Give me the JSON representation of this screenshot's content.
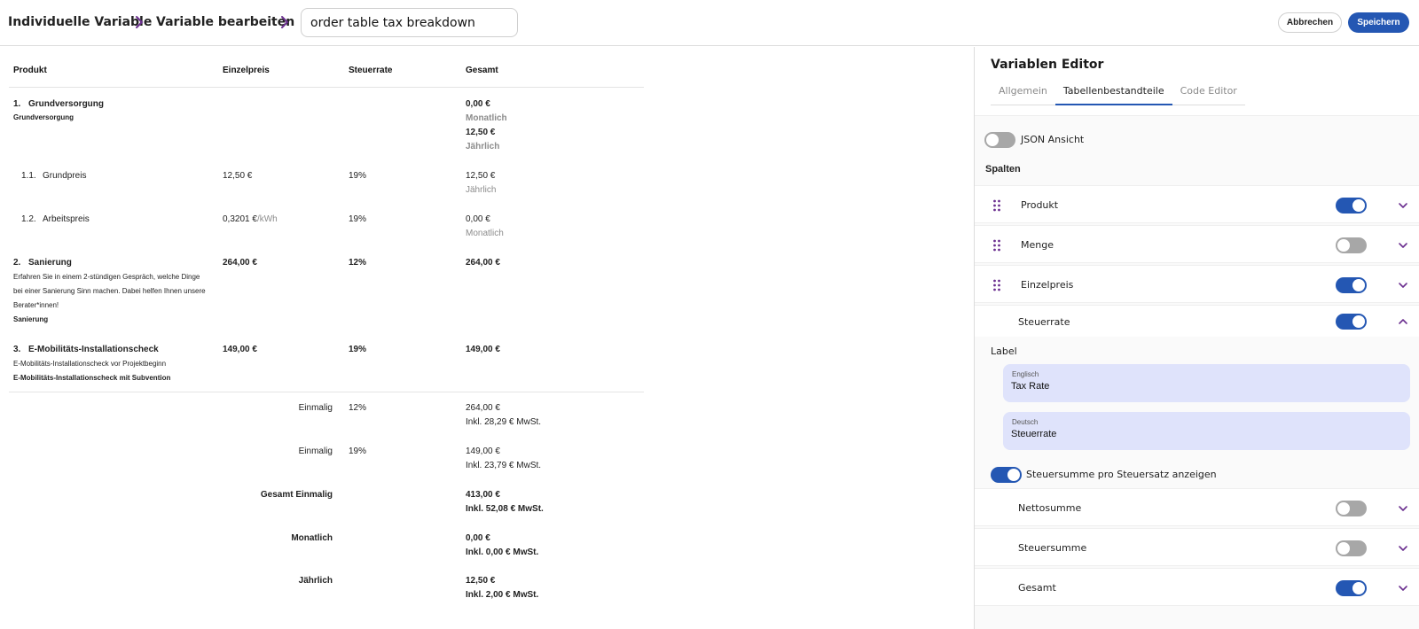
{
  "header": {
    "breadcrumb_1": "Individuelle Variable",
    "breadcrumb_2": "Variable bearbeiten",
    "title_value": "order table tax breakdown",
    "cancel_label": "Abbrechen",
    "save_label": "Speichern"
  },
  "table": {
    "headers": {
      "produkt": "Produkt",
      "einzelpreis": "Einzelpreis",
      "steuerrate": "Steuerrate",
      "gesamt": "Gesamt"
    },
    "item1": {
      "number": "1.",
      "name": "Grundversorgung",
      "subtitle": "Grundversorgung",
      "total_1": "0,00 €",
      "period_1": "Monatlich",
      "total_2": "12,50 €",
      "period_2": "Jährlich"
    },
    "item1_1": {
      "number": "1.1.",
      "name": "Grundpreis",
      "price": "12,50 €",
      "rate": "19%",
      "total": "12,50 €",
      "period": "Jährlich"
    },
    "item1_2": {
      "number": "1.2.",
      "name": "Arbeitspreis",
      "price": "0,3201 €",
      "unit": "/kWh",
      "rate": "19%",
      "total": "0,00 €",
      "period": "Monatlich"
    },
    "item2": {
      "number": "2.",
      "name": "Sanierung",
      "price": "264,00 €",
      "rate": "12%",
      "total": "264,00 €",
      "desc_1": "Erfahren Sie in einem 2-stündigen Gespräch, welche Dinge",
      "desc_2": "bei einer Sanierung Sinn machen. Dabei helfen Ihnen unsere",
      "desc_3": "Berater*innen!",
      "subtitle": "Sanierung"
    },
    "item3": {
      "number": "3.",
      "name": "E-Mobilitäts-Installationscheck",
      "price": "149,00 €",
      "rate": "19%",
      "total": "149,00 €",
      "desc_1": "E-Mobilitäts-Installationscheck vor Projektbeginn",
      "subtitle": "E-Mobilitäts-Installationscheck mit Subvention"
    },
    "summary": {
      "s1": {
        "label": "Einmalig",
        "rate": "12%",
        "amount": "264,00 €",
        "tax": "Inkl. 28,29 € MwSt."
      },
      "s2": {
        "label": "Einmalig",
        "rate": "19%",
        "amount": "149,00 €",
        "tax": "Inkl. 23,79 € MwSt."
      },
      "s3": {
        "label": "Gesamt Einmalig",
        "amount": "413,00 €",
        "tax": "Inkl. 52,08 € MwSt."
      },
      "s4": {
        "label": "Monatlich",
        "amount": "0,00 €",
        "tax": "Inkl. 0,00 € MwSt."
      },
      "s5": {
        "label": "Jährlich",
        "amount": "12,50 €",
        "tax": "Inkl. 2,00 € MwSt."
      }
    }
  },
  "panel": {
    "title": "Variablen Editor",
    "tabs": [
      "Allgemein",
      "Tabellenbestandteile",
      "Code Editor"
    ],
    "active_tab": "Tabellenbestandteile",
    "json_toggle_label": "JSON Ansicht",
    "json_toggle_on": false,
    "columns_label": "Spalten",
    "columns": [
      {
        "label": "Produkt",
        "enabled": true
      },
      {
        "label": "Menge",
        "enabled": false
      },
      {
        "label": "Einzelpreis",
        "enabled": true
      },
      {
        "label": "Steuerrate",
        "enabled": true
      }
    ],
    "label_section": "Label",
    "label_en_caption": "Englisch",
    "label_en_value": "Tax Rate",
    "label_de_caption": "Deutsch",
    "label_de_value": "Steuerrate",
    "tax_sum_toggle_label": "Steuersumme pro Steuersatz anzeigen",
    "tax_sum_toggle_on": true,
    "sums": [
      {
        "label": "Nettosumme",
        "enabled": false
      },
      {
        "label": "Steuersumme",
        "enabled": false
      },
      {
        "label": "Gesamt",
        "enabled": true
      }
    ]
  },
  "colors": {
    "accent": "#2457b3",
    "breadcrumb_chevron": "#6b2f8f",
    "field_bg": "#dfe3fb",
    "switch_off": "#a7a7a7"
  }
}
